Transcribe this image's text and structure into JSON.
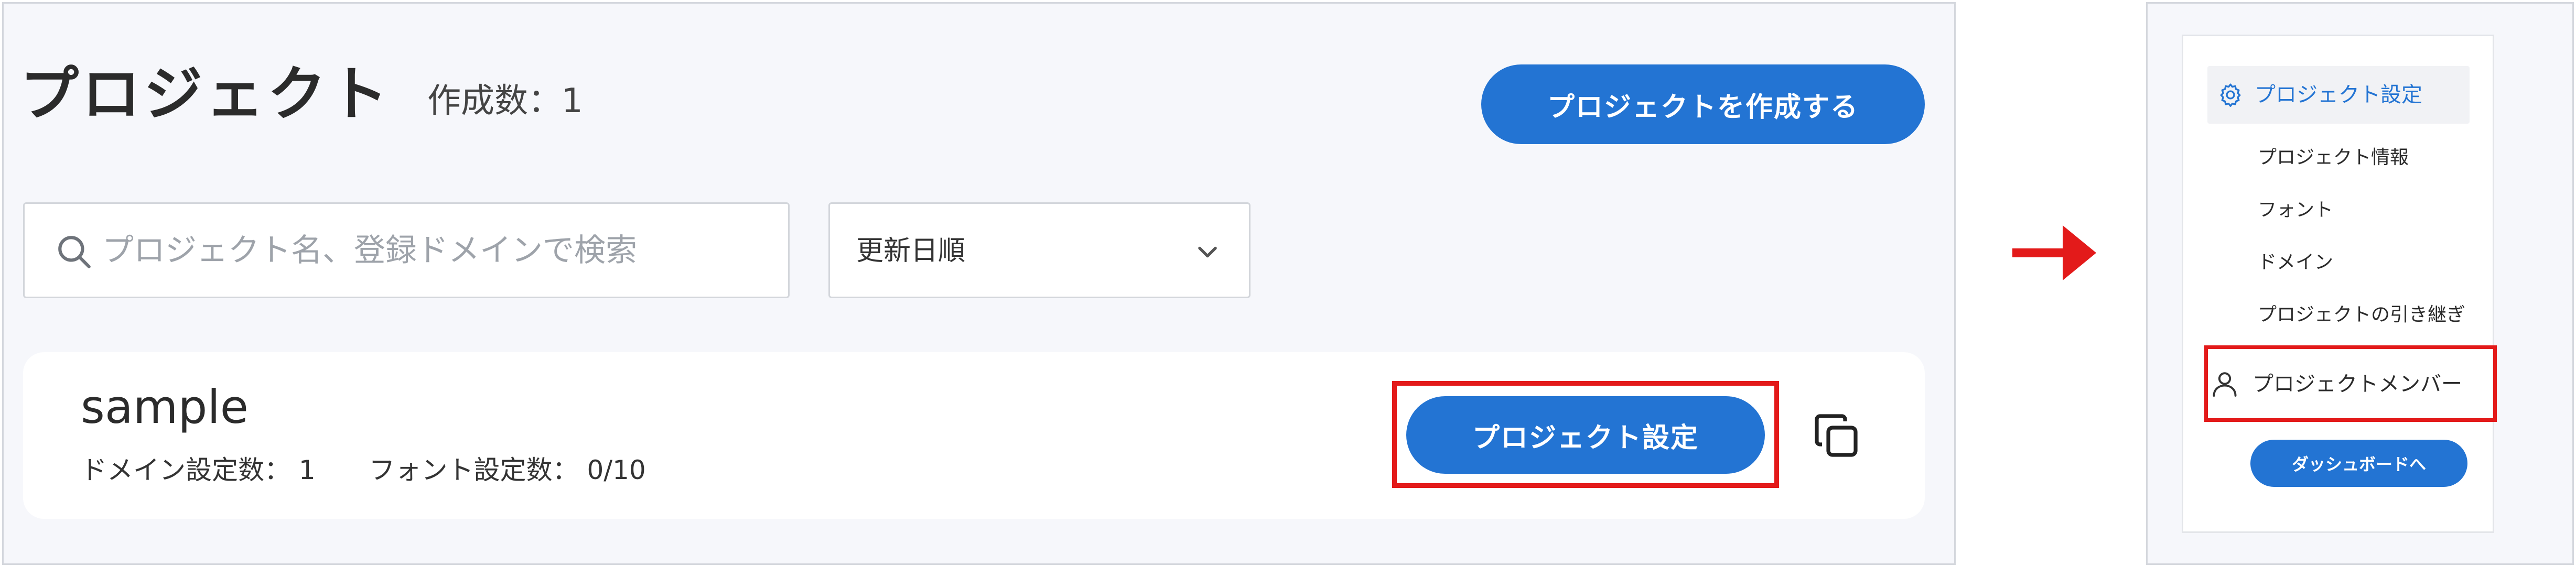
{
  "main": {
    "title": "プロジェクト",
    "count_label": "作成数：",
    "count_value": "1",
    "create_button_label": "プロジェクトを作成する",
    "search": {
      "placeholder": "プロジェクト名、登録ドメインで検索"
    },
    "sort": {
      "selected": "更新日順"
    },
    "project_card": {
      "name": "sample",
      "domain_label": "ドメイン設定数：",
      "domain_value": "1",
      "font_label": "フォント設定数：",
      "font_value": "0/10",
      "settings_button_label": "プロジェクト設定"
    }
  },
  "sidebar": {
    "header_label": "プロジェクト設定",
    "items": [
      {
        "label": "プロジェクト情報"
      },
      {
        "label": "フォント"
      },
      {
        "label": "ドメイン"
      },
      {
        "label": "プロジェクトの引き継ぎ"
      }
    ],
    "members_label": "プロジェクトメンバー",
    "dashboard_button_label": "ダッシュボードへ"
  },
  "colors": {
    "accent": "#2374d3",
    "highlight": "#e31a1a",
    "panel_bg": "#f6f7fb",
    "border": "#d4d7dd"
  },
  "icons": [
    "search-icon",
    "chevron-down-icon",
    "copy-icon",
    "arrow-right-icon",
    "gear-icon",
    "user-icon"
  ]
}
